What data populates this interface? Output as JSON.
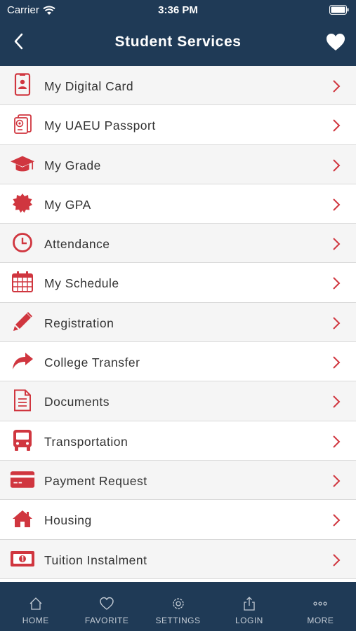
{
  "status_bar": {
    "carrier": "Carrier",
    "time": "3:36 PM"
  },
  "nav": {
    "title": "Student Services"
  },
  "services": [
    {
      "label": "My Digital Card",
      "icon": "id-card-icon"
    },
    {
      "label": "My UAEU Passport",
      "icon": "passport-icon"
    },
    {
      "label": "My Grade",
      "icon": "graduation-cap-icon"
    },
    {
      "label": "My GPA",
      "icon": "badge-icon"
    },
    {
      "label": "Attendance",
      "icon": "clock-icon"
    },
    {
      "label": "My Schedule",
      "icon": "calendar-icon"
    },
    {
      "label": "Registration",
      "icon": "pencil-icon"
    },
    {
      "label": "College Transfer",
      "icon": "share-arrow-icon"
    },
    {
      "label": "Documents",
      "icon": "document-icon"
    },
    {
      "label": "Transportation",
      "icon": "bus-icon"
    },
    {
      "label": "Payment Request",
      "icon": "credit-card-icon"
    },
    {
      "label": "Housing",
      "icon": "home-icon"
    },
    {
      "label": "Tuition Instalment",
      "icon": "money-icon"
    }
  ],
  "tabbar": {
    "home": "HOME",
    "favorite": "FAVORITE",
    "settings": "SETTINGS",
    "login": "LOGIN",
    "more": "MORE"
  },
  "colors": {
    "header": "#1f3a56",
    "accent": "#d0363f",
    "tab_text": "#c4ccd5"
  }
}
